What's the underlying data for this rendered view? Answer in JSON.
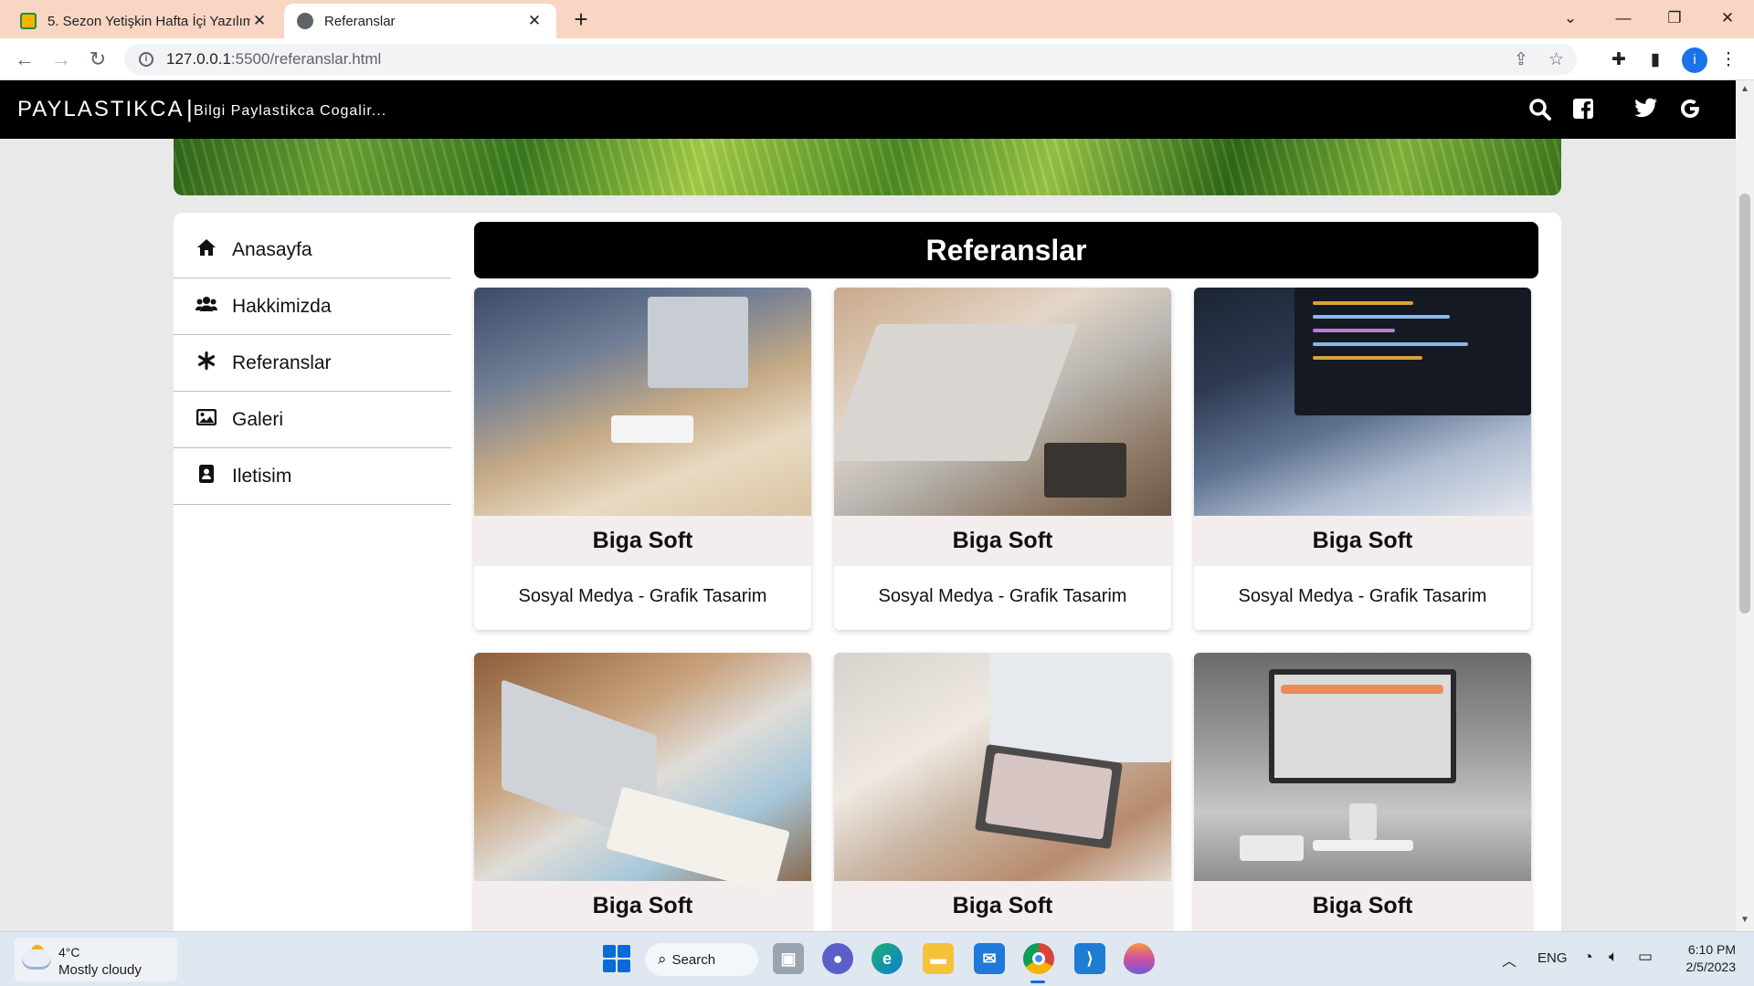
{
  "browser": {
    "tabs": [
      {
        "title": "5. Sezon Yetişkin Hafta İçi Yazılım",
        "close": "✕"
      },
      {
        "title": "Referanslar",
        "close": "✕"
      }
    ],
    "new_tab": "+",
    "url_host": "127.0.0.1",
    "url_rest": ":5500/referanslar.html",
    "profile_initial": "i"
  },
  "site": {
    "brand": "PAYLASTIKCA",
    "separator": "|",
    "slogan": "Bilgi Paylastikca Cogalir..."
  },
  "nav": {
    "items": [
      {
        "label": "Anasayfa",
        "icon": "home-icon"
      },
      {
        "label": "Hakkimizda",
        "icon": "users-icon"
      },
      {
        "label": "Referanslar",
        "icon": "asterisk-icon"
      },
      {
        "label": "Galeri",
        "icon": "image-icon"
      },
      {
        "label": "Iletisim",
        "icon": "contact-icon"
      }
    ]
  },
  "main": {
    "heading": "Referanslar",
    "cards": [
      {
        "title": "Biga Soft",
        "desc": "Sosyal Medya - Grafik Tasarim"
      },
      {
        "title": "Biga Soft",
        "desc": "Sosyal Medya - Grafik Tasarim"
      },
      {
        "title": "Biga Soft",
        "desc": "Sosyal Medya - Grafik Tasarim"
      },
      {
        "title": "Biga Soft",
        "desc": ""
      },
      {
        "title": "Biga Soft",
        "desc": ""
      },
      {
        "title": "Biga Soft",
        "desc": ""
      }
    ]
  },
  "taskbar": {
    "weather_temp": "4°C",
    "weather_cond": "Mostly cloudy",
    "search_label": "Search",
    "language": "ENG",
    "time": "6:10 PM",
    "date": "2/5/2023"
  }
}
